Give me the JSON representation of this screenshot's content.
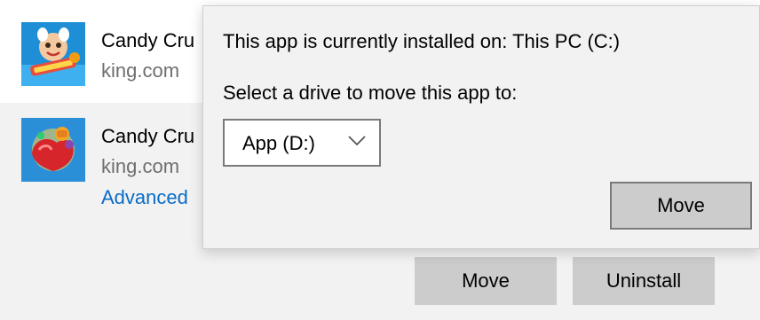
{
  "apps": [
    {
      "name": "Candy Cru",
      "publisher": "king.com",
      "icon": "candy-crush-friends-icon"
    },
    {
      "name": "Candy Cru",
      "publisher": "king.com",
      "icon": "candy-crush-saga-icon",
      "advanced_label": "Advanced",
      "move_label": "Move",
      "uninstall_label": "Uninstall"
    }
  ],
  "flyout": {
    "installed_on": "This app is currently installed on: This PC (C:)",
    "select_prompt": "Select a drive to move this app to:",
    "selected_drive": "App (D:)",
    "move_label": "Move"
  },
  "colors": {
    "selected_row_bg": "#f2f2f2",
    "button_bg": "#cccccc",
    "link": "#0a6cc6",
    "secondary_text": "#6e6e6e"
  }
}
